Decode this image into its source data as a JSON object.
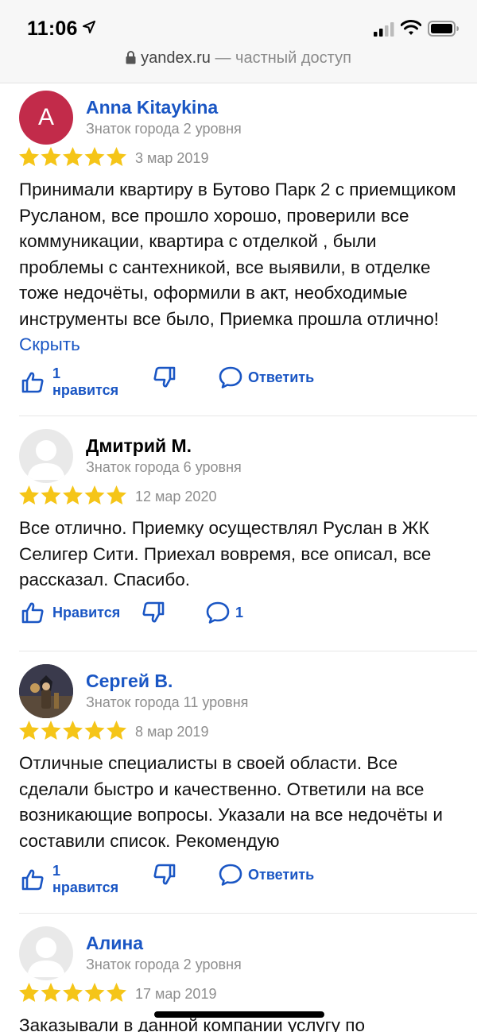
{
  "status_bar": {
    "time": "11:06"
  },
  "address_bar": {
    "domain": "yandex.ru",
    "suffix": " — частный доступ"
  },
  "colors": {
    "link": "#1a56c4",
    "star": "#f5c518",
    "muted": "#8e8e8e",
    "avatar_anna": "#c22b4a"
  },
  "reviews": [
    {
      "avatar_letter": "A",
      "name": "Anna Kitaykina",
      "level": "Знаток города 2 уровня",
      "rating": 5,
      "date": "3 мар 2019",
      "text": "Принимали квартиру в Бутово Парк 2 с приемщиком Русланом, все прошло хорошо, проверили все коммуникации, квартира с отделкой , были проблемы с сантехникой, все выявили, в отделке тоже недочёты, оформили в акт, необходимые инструменты все было, Приемка прошла отлично!",
      "toggle": "Скрыть",
      "like_label": "1 нравится",
      "reply_label": "Ответить"
    },
    {
      "name": "Дмитрий М.",
      "level": "Знаток города 6 уровня",
      "rating": 5,
      "date": "12 мар 2020",
      "text": "Все отлично. Приемку осуществлял Руслан в ЖК Селигер Сити. Приехал вовремя, все описал, все рассказал. Спасибо.",
      "like_label": "Нравится",
      "comments_count": "1"
    },
    {
      "name": "Сергей В.",
      "level": "Знаток города 11 уровня",
      "rating": 5,
      "date": "8 мар 2019",
      "text": "Отличные специалисты в своей области. Все сделали быстро и качественно. Ответили на все возникающие вопросы. Указали на все недочёты и составили список. Рекомендую",
      "like_label": "1 нравится",
      "reply_label": "Ответить"
    },
    {
      "name": "Алина",
      "level": "Знаток города 2 уровня",
      "rating": 5,
      "date": "17 мар 2019",
      "text": "Заказывали в данной компании услугу по"
    }
  ]
}
